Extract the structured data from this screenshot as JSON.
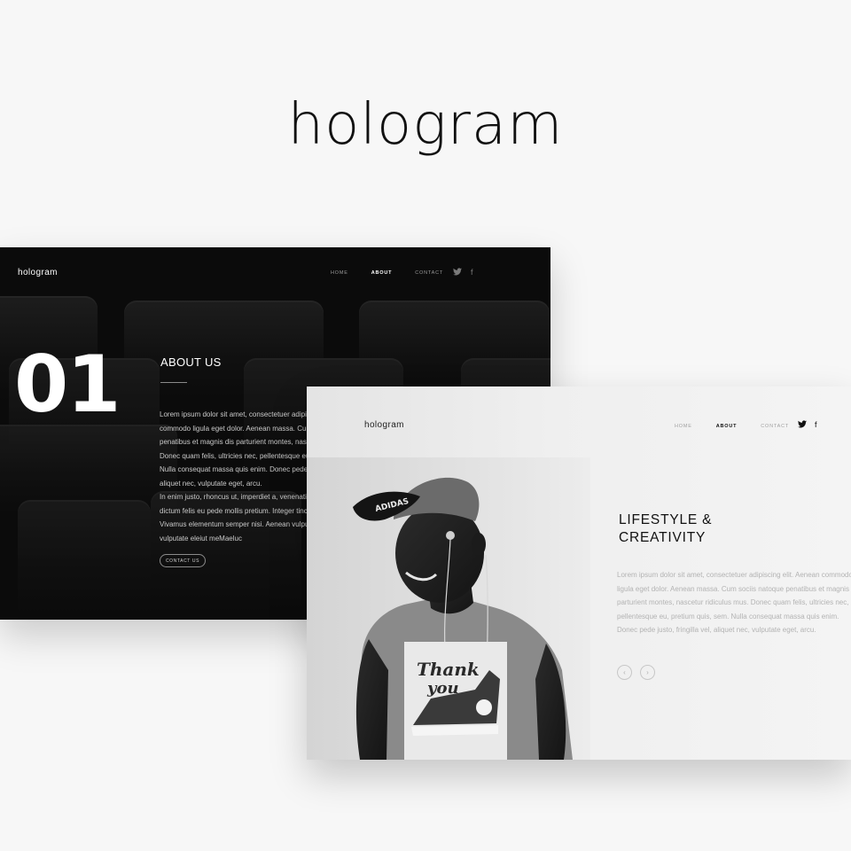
{
  "brand": {
    "title": "hologram"
  },
  "dark_card": {
    "logo": "hologram",
    "nav": [
      {
        "label": "HOME",
        "active": false
      },
      {
        "label": "ABOUT",
        "active": true
      },
      {
        "label": "CONTACT",
        "active": false
      }
    ],
    "social_icons": [
      "twitter-icon",
      "facebook-icon"
    ],
    "social_glyphs": {
      "twitter": "🐦",
      "facebook": "f"
    },
    "number": "01",
    "heading": "ABOUT US",
    "paragraph_1": "Lorem ipsum dolor sit amet, consectetuer adipiscing elit. Aenean commodo ligula eget dolor. Aenean massa. Cum sociis natoque penatibus et magnis dis parturient montes, nascetur ridiculus mus. Donec quam felis, ultricies nec, pellentesque eu, pretium quis, sem. Nulla consequat massa quis enim. Donec pede justo, fringilla vel, aliquet nec, vulputate eget, arcu.",
    "paragraph_2": "In enim justo, rhoncus ut, imperdiet a, venenatis vitae, justo. Nullam dictum felis eu pede mollis pretium. Integer tincidunt. Cras dapibus. Vivamus elementum semper nisi. Aenean vulputate eleifend tellus. vulputate eleiut meMaeluc",
    "contact_button": "CONTACT US"
  },
  "light_card": {
    "logo": "hologram",
    "nav": [
      {
        "label": "HOME",
        "active": false
      },
      {
        "label": "ABOUT",
        "active": true
      },
      {
        "label": "CONTACT",
        "active": false
      }
    ],
    "social_icons": [
      "twitter-icon",
      "facebook-icon"
    ],
    "social_glyphs": {
      "twitter": "🐦",
      "facebook": "f"
    },
    "heading_line_1": "LIFESTYLE &",
    "heading_line_2": "CREATIVITY",
    "paragraph": "Lorem ipsum dolor sit amet, consectetuer adipiscing elit. Aenean commodo ligula eget dolor. Aenean massa. Cum sociis natoque penatibus et magnis dis parturient montes, nascetur ridiculus mus. Donec quam felis, ultricies nec, pellentesque eu, pretium quis, sem. Nulla consequat massa quis enim. Donec pede justo, fringilla vel, aliquet nec, vulputate eget, arcu.",
    "arrows": {
      "prev": "‹",
      "next": "›"
    },
    "photo_text": {
      "cap": "ADIDAS",
      "shirt_line_1": "Thank",
      "shirt_line_2": "you"
    }
  }
}
